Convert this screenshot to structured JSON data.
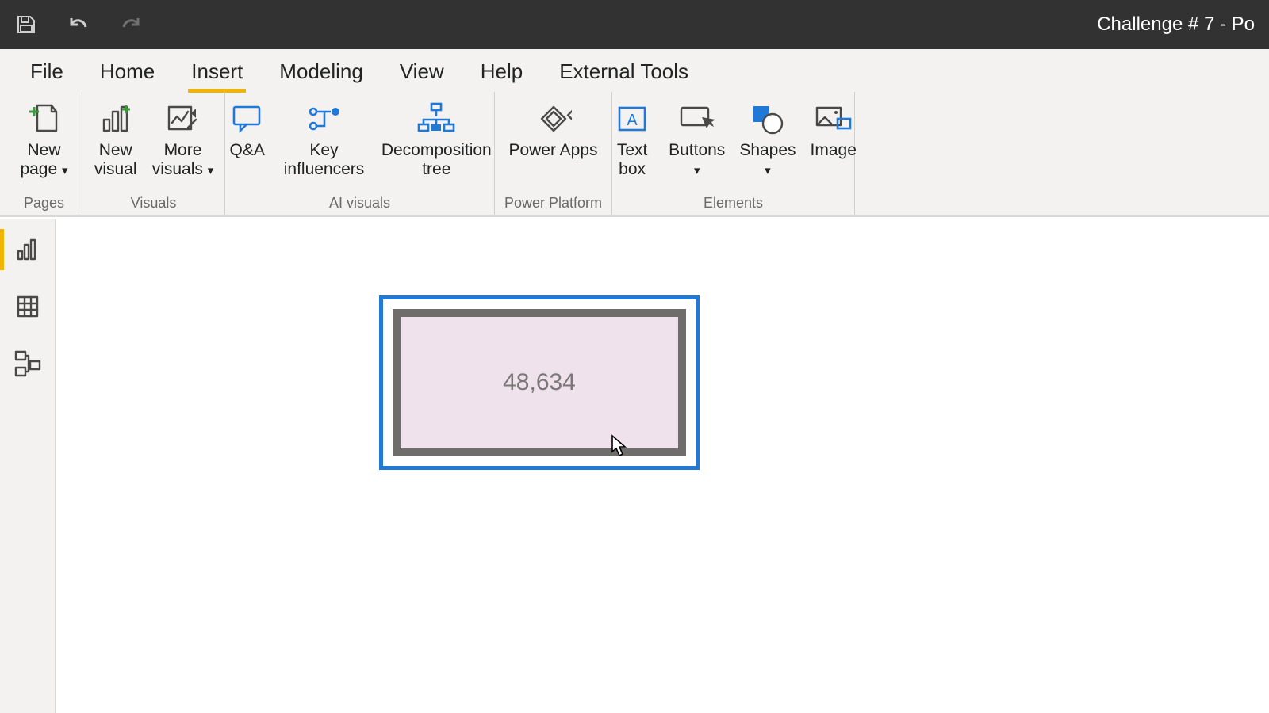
{
  "window": {
    "title": "Challenge # 7 - Po"
  },
  "tabs": {
    "file": "File",
    "home": "Home",
    "insert": "Insert",
    "modeling": "Modeling",
    "view": "View",
    "help": "Help",
    "external": "External Tools",
    "active": "insert"
  },
  "ribbon": {
    "groups": {
      "pages": {
        "label": "Pages",
        "new_page": "New\npage"
      },
      "visuals": {
        "label": "Visuals",
        "new_visual": "New\nvisual",
        "more_visuals": "More\nvisuals"
      },
      "ai": {
        "label": "AI visuals",
        "qa": "Q&A",
        "key_influencers": "Key\ninfluencers",
        "decomposition": "Decomposition\ntree"
      },
      "platform": {
        "label": "Power Platform",
        "powerapps": "Power Apps"
      },
      "elements": {
        "label": "Elements",
        "textbox": "Text\nbox",
        "buttons": "Buttons",
        "shapes": "Shapes",
        "image": "Image"
      }
    }
  },
  "canvas": {
    "card": {
      "value": "48,634"
    }
  }
}
